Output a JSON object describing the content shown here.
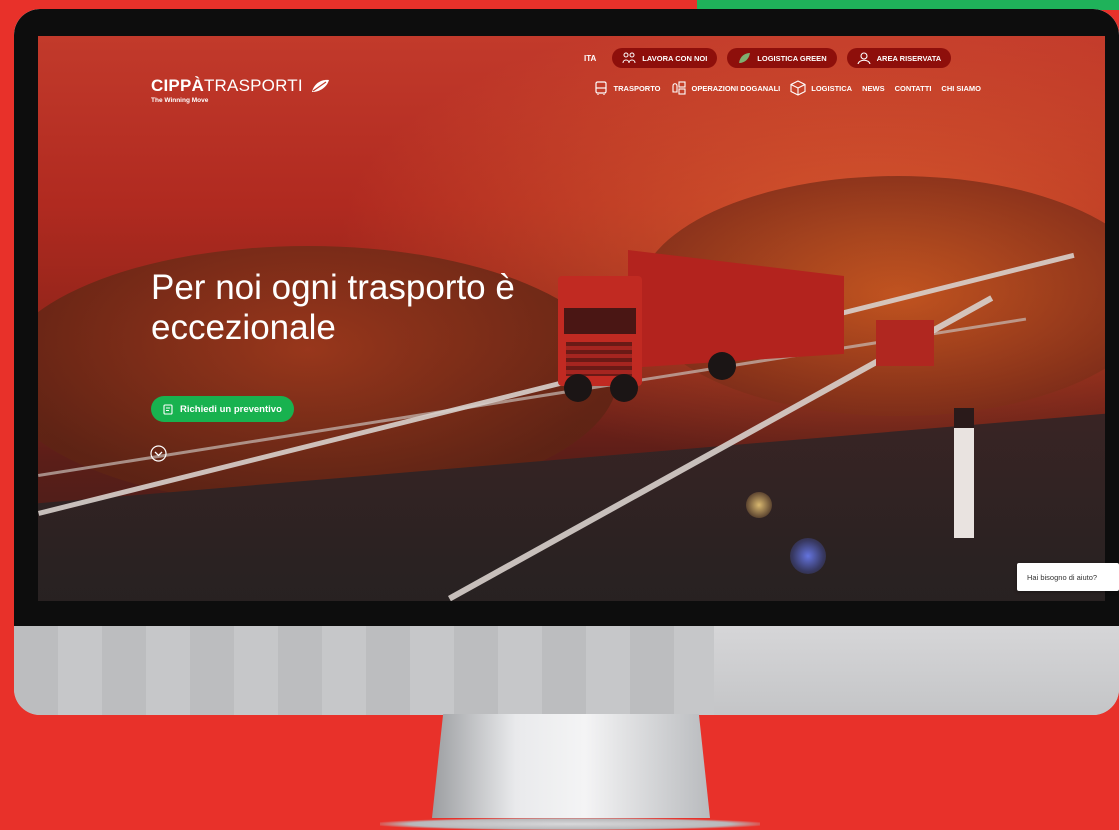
{
  "header": {
    "logo": {
      "brand_bold": "CIPPÀ",
      "brand_light": "TRASPORTI",
      "tagline": "The Winning Move"
    },
    "language": "ITA",
    "top_links": [
      {
        "label": "LAVORA CON NOI",
        "icon": "people-icon"
      },
      {
        "label": "LOGISTICA GREEN",
        "icon": "leaf-icon"
      },
      {
        "label": "AREA RISERVATA",
        "icon": "user-icon"
      }
    ],
    "nav": [
      {
        "label": "TRASPORTO",
        "icon": "truck-icon"
      },
      {
        "label": "OPERAZIONI DOGANALI",
        "icon": "customs-icon"
      },
      {
        "label": "LOGISTICA",
        "icon": "box-icon"
      },
      {
        "label": "NEWS"
      },
      {
        "label": "CONTATTI"
      },
      {
        "label": "CHI SIAMO"
      }
    ]
  },
  "hero": {
    "headline_line1": "Per noi ogni trasporto è",
    "headline_line2": "eccezionale",
    "cta_label": "Richiedi un preventivo",
    "scroll_icon": "chevron-down-circle-icon"
  },
  "help_widget": {
    "label": "Hai bisogno di aiuto?"
  },
  "colors": {
    "background": "#e8312a",
    "accent_green": "#1fb25a",
    "pill_dark_red": "#8e0f0b",
    "cta_green": "#18b24f"
  }
}
